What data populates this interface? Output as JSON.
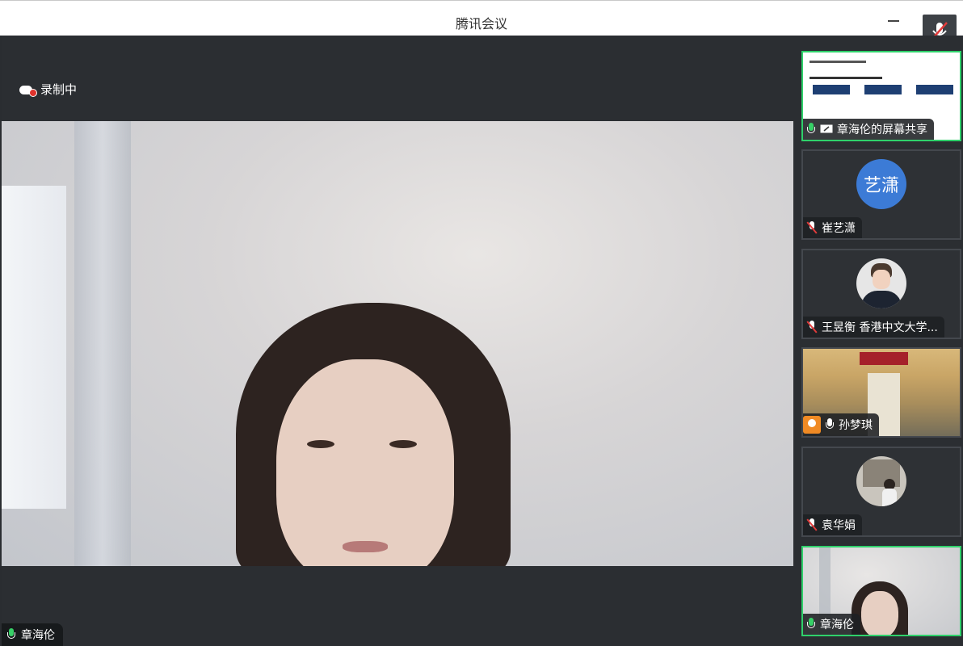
{
  "window": {
    "title": "腾讯会议"
  },
  "recording": {
    "label": "录制中"
  },
  "main_video": {
    "participant": "章海伦"
  },
  "sidebar": {
    "tiles": [
      {
        "label": "章海伦的屏幕共享",
        "type": "screen-share",
        "active": true
      },
      {
        "label": "崔艺潇",
        "type": "avatar",
        "avatar_text": "艺潇",
        "muted": true
      },
      {
        "label": "王昱衡 香港中文大学...",
        "type": "photo",
        "muted": true
      },
      {
        "label": "孙梦琪",
        "type": "video",
        "muted": false
      },
      {
        "label": "袁华娟",
        "type": "photo",
        "muted": true
      },
      {
        "label": "章海伦",
        "type": "video",
        "active": true,
        "muted": false
      }
    ]
  },
  "colors": {
    "active_border": "#2fd16b",
    "avatar_bg": "#3c7bd6",
    "record_dot": "#e0332d"
  }
}
